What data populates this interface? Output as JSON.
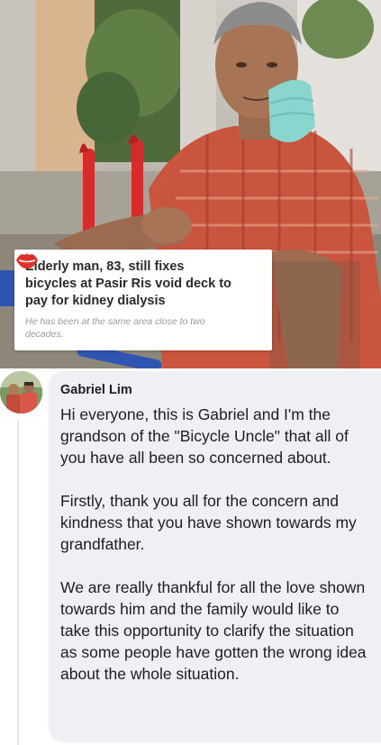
{
  "post_image": {
    "headline": "Elderly man, 83, still fixes bicycles at Pasir Ris void deck to pay for kidney dialysis",
    "subheadline": "He has been at the same area close to two decades.",
    "brand_icon": "red-lips-logo-icon",
    "colors": {
      "shirt": "#c9553f",
      "mask": "#8ad6cf",
      "bike_frame": "#d42b2b"
    }
  },
  "comment": {
    "author": "Gabriel Lim",
    "avatar_icon": "user-avatar-photo",
    "paragraphs": [
      "Hi everyone, this is Gabriel and I'm the grandson of the \"Bicycle Uncle\" that all of you have all been so concerned about.",
      "Firstly, thank you all for the concern and kindness that you have shown towards my grandfather.",
      "We are really thankful for all the love shown towards him and the family would like to take this opportunity to clarify the situation as some people have gotten the wrong idea about the whole situation."
    ],
    "colors": {
      "bubble_bg": "#eef0f3",
      "text": "#1c1e21"
    }
  }
}
